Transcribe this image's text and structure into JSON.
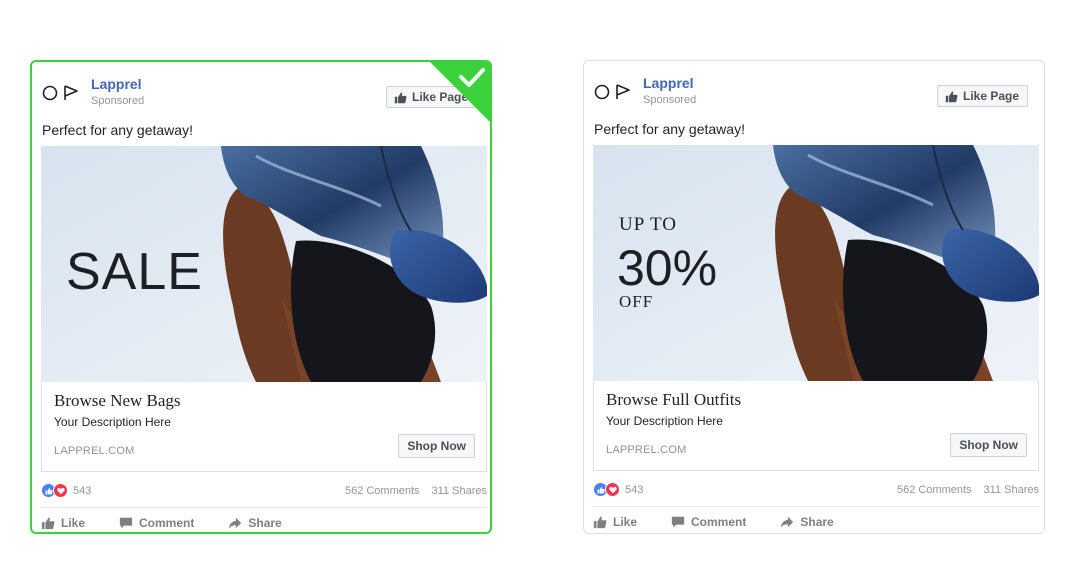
{
  "colors": {
    "brand_blue": "#4267b2",
    "selected_border": "#3ad13a",
    "like_blue": "#4a7ff5",
    "love_red": "#f2344f"
  },
  "ads": [
    {
      "page_name": "Lapprel",
      "sponsored": "Sponsored",
      "like_page": "Like Page",
      "post_text": "Perfect for any getaway!",
      "creative_text": [
        "SALE"
      ],
      "headline": "Browse New Bags",
      "description": "Your Description Here",
      "domain": "LAPPREL.COM",
      "cta": "Shop Now",
      "reaction_count": "543",
      "comments": "562 Comments",
      "shares": "311 Shares",
      "actions": {
        "like": "Like",
        "comment": "Comment",
        "share": "Share"
      },
      "selected": true,
      "icons": [
        "thumbs-up-icon",
        "checkmark-icon",
        "comment-icon",
        "share-icon"
      ]
    },
    {
      "page_name": "Lapprel",
      "sponsored": "Sponsored",
      "like_page": "Like Page",
      "post_text": "Perfect for any getaway!",
      "creative_text": [
        "UP TO",
        "30%",
        "OFF"
      ],
      "headline": "Browse Full Outfits",
      "description": "Your Description Here",
      "domain": "LAPPREL.COM",
      "cta": "Shop Now",
      "reaction_count": "543",
      "comments": "562 Comments",
      "shares": "311 Shares",
      "actions": {
        "like": "Like",
        "comment": "Comment",
        "share": "Share"
      },
      "selected": false,
      "icons": [
        "thumbs-up-icon",
        "comment-icon",
        "share-icon"
      ]
    }
  ]
}
